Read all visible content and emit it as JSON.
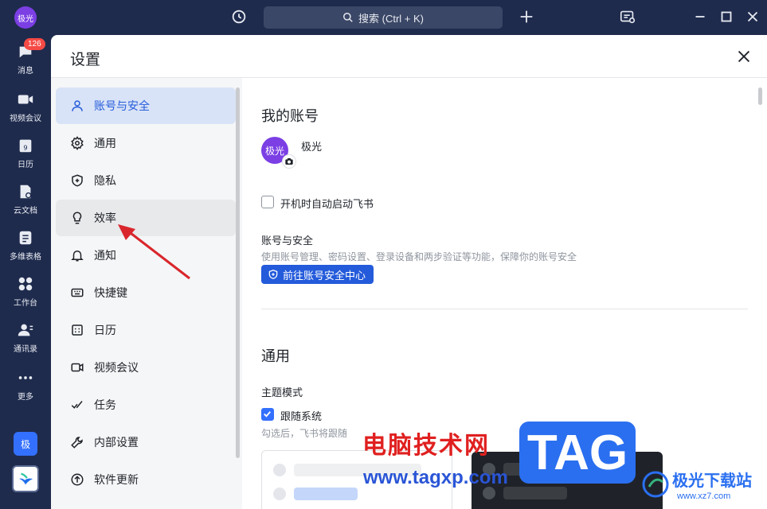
{
  "titlebar": {
    "user_avatar": "极光",
    "search_placeholder": "搜索 (Ctrl + K)"
  },
  "rail": {
    "messages": {
      "label": "消息",
      "badge": "126"
    },
    "video_meeting": "视频会议",
    "calendar": {
      "label": "日历",
      "day": "9"
    },
    "docs": "云文档",
    "base": "多维表格",
    "workplace": "工作台",
    "contacts": "通讯录",
    "more": "更多",
    "org_logo": "极"
  },
  "dialog": {
    "title": "设置"
  },
  "nav": {
    "items": [
      {
        "label": "账号与安全",
        "icon": "person-icon"
      },
      {
        "label": "通用",
        "icon": "gear-icon"
      },
      {
        "label": "隐私",
        "icon": "shield-icon"
      },
      {
        "label": "效率",
        "icon": "lightbulb-icon"
      },
      {
        "label": "通知",
        "icon": "bell-icon"
      },
      {
        "label": "快捷键",
        "icon": "keyboard-icon"
      },
      {
        "label": "日历",
        "icon": "calendar-icon"
      },
      {
        "label": "视频会议",
        "icon": "video-icon"
      },
      {
        "label": "任务",
        "icon": "task-check-icon"
      },
      {
        "label": "内部设置",
        "icon": "wrench-icon"
      },
      {
        "label": "软件更新",
        "icon": "update-arrow-icon"
      }
    ]
  },
  "content": {
    "my_account_heading": "我的账号",
    "avatar_text": "极光",
    "username": "极光",
    "autostart_label": "开机时自动启动飞书",
    "account_security_title": "账号与安全",
    "account_security_desc": "使用账号管理、密码设置、登录设备和两步验证等功能，保障你的账号安全",
    "security_center_button": "前往账号安全中心",
    "general_heading": "通用",
    "theme_mode_label": "主题模式",
    "follow_system_label": "跟随系统",
    "follow_system_desc": "勾选后，飞书将跟随"
  },
  "watermark": {
    "site_title": "电脑技术网",
    "site_url": "www.tagxp.com",
    "tag_text": "TAG",
    "jg_name": "极光下载站",
    "jg_url": "www.xz7.com"
  },
  "colors": {
    "accent": "#245bdb",
    "rail_bg": "#1f2b4d",
    "active_nav_bg": "#d9e3f7",
    "avatar_purple": "#7b3fe4",
    "badge_red": "#f54a45"
  }
}
